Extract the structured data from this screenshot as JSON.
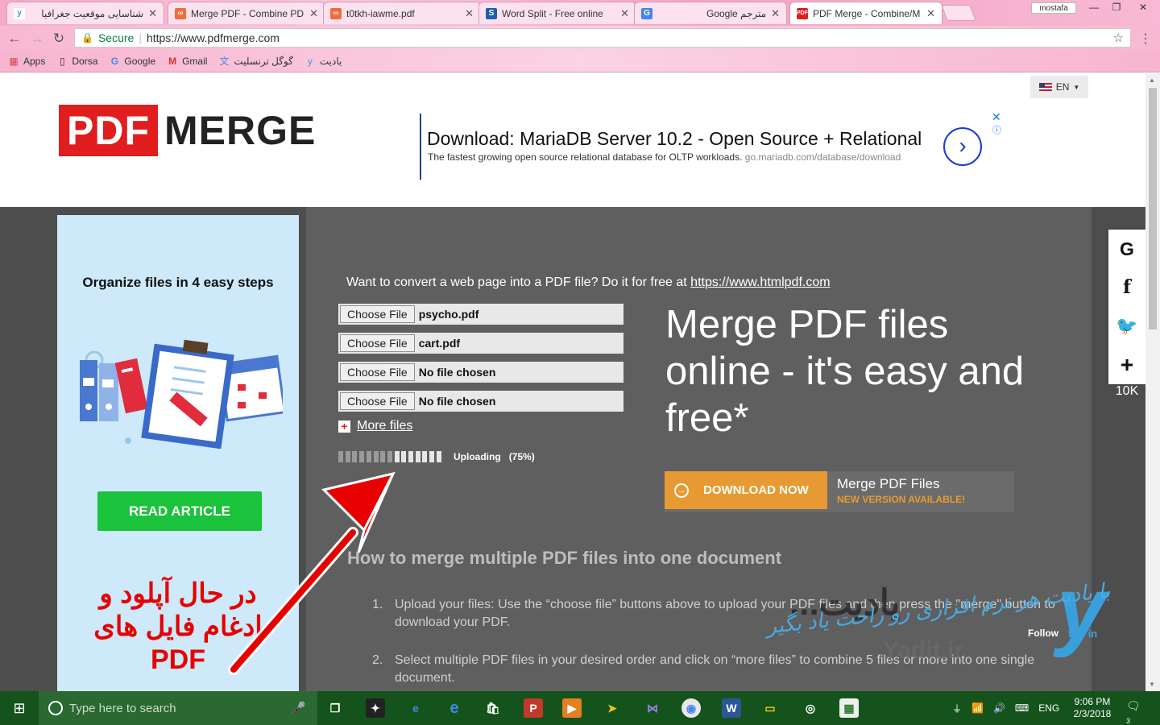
{
  "browser": {
    "tabs": [
      {
        "title": "شناسایی موقعیت جغرافیا",
        "icon": "yadit-favicon"
      },
      {
        "title": "Merge PDF - Combine PD",
        "icon": "smallpdf-favicon"
      },
      {
        "title": "t0tkh-iawme.pdf",
        "icon": "smallpdf-favicon"
      },
      {
        "title": "Word Split - Free online",
        "icon": "s-favicon"
      },
      {
        "title": "Google مترجم",
        "icon": "translate-favicon"
      },
      {
        "title": "PDF Merge - Combine/M",
        "icon": "pdf-favicon",
        "active": true
      }
    ],
    "profile": "mostafa",
    "address": {
      "secure_label": "Secure",
      "url": "https://www.pdfmerge.com"
    },
    "bookmarks": [
      "Apps",
      "Dorsa",
      "Google",
      "Gmail",
      "گوگل ترنسلیت",
      "یادیت"
    ]
  },
  "page": {
    "logo": {
      "part1": "PDF",
      "part2": "MERGE"
    },
    "language": "EN",
    "ad": {
      "title": "Download: MariaDB Server 10.2 - Open Source + Relational",
      "description": "The fastest growing open source relational database for OLTP workloads.",
      "domain": "go.mariadb.com/database/download"
    },
    "side_ad": {
      "title": "Organize files in 4 easy steps",
      "button": "READ ARTICLE",
      "note_lines": [
        "در حال آپلود و",
        "ادغام فایل های",
        "PDF"
      ]
    },
    "promo": {
      "text": "Want to convert a web page into a PDF file? Do it for free at ",
      "link": "https://www.htmlpdf.com"
    },
    "files": [
      {
        "button": "Choose File",
        "name": "psycho.pdf"
      },
      {
        "button": "Choose File",
        "name": "cart.pdf"
      },
      {
        "button": "Choose File",
        "name": "No file chosen"
      },
      {
        "button": "Choose File",
        "name": "No file chosen"
      }
    ],
    "more_files": "More files",
    "upload": {
      "status": "Uploading",
      "percent_label": "(75%)",
      "progress": 0.75
    },
    "headline": "Merge PDF files online - it's easy and free*",
    "download": {
      "button": "DOWNLOAD NOW",
      "product": "Merge PDF Files",
      "note": "NEW VERSION AVAILABLE!"
    },
    "howto": {
      "title": "How to merge multiple PDF files into one document",
      "steps": [
        {
          "num": "1.",
          "text": "Upload your files: Use the “choose file” buttons above to upload your PDF files and then press the \"merge\" button to download your PDF."
        },
        {
          "num": "2.",
          "text": "Select multiple PDF files in your desired order and click on “more files” to combine 5 files or more into one single document."
        }
      ]
    },
    "share": {
      "count": "10K"
    },
    "watermark": {
      "fa": "یادیت...",
      "domain": "Yadit.ir",
      "follow": "Follow",
      "tagline": "با یادیت هر نرم افزاری رو راحت یاد بگیر"
    }
  },
  "taskbar": {
    "search_placeholder": "Type here to search",
    "lang": "ENG",
    "time": "9:06 PM",
    "date": "2/3/2018",
    "notifications": "3"
  }
}
